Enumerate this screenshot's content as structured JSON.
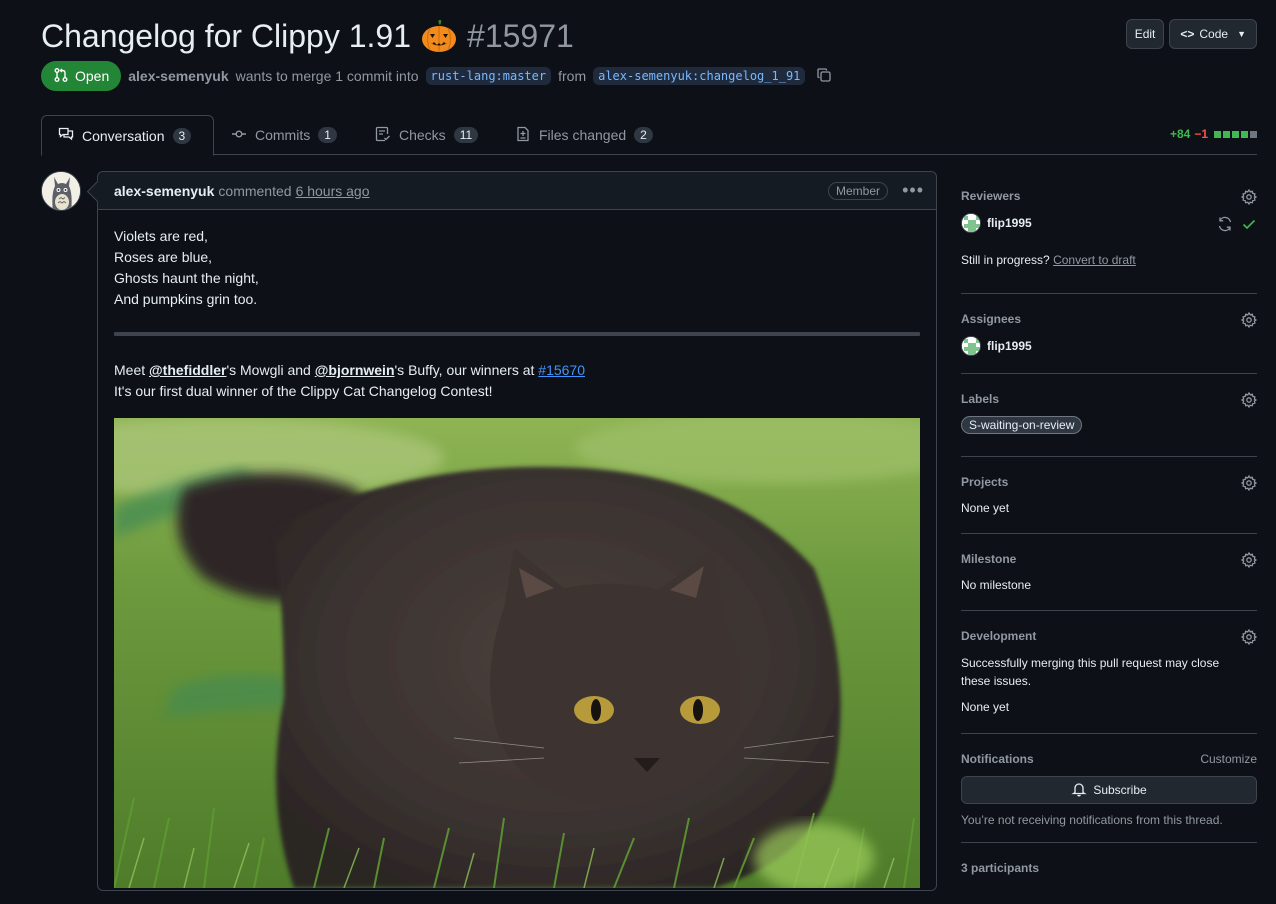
{
  "header": {
    "title": "Changelog for Clippy 1.91",
    "number": "#15971",
    "edit_label": "Edit",
    "code_label": "Code"
  },
  "meta": {
    "state": "Open",
    "author": "alex-semenyuk",
    "merge_text": "wants to merge 1 commit into",
    "base_branch": "rust-lang:master",
    "from_text": "from",
    "head_branch": "alex-semenyuk:changelog_1_91"
  },
  "tabs": [
    {
      "label": "Conversation",
      "count": "3"
    },
    {
      "label": "Commits",
      "count": "1"
    },
    {
      "label": "Checks",
      "count": "11"
    },
    {
      "label": "Files changed",
      "count": "2"
    }
  ],
  "diffstat": {
    "additions": "+84",
    "deletions": "−1",
    "blocks": [
      "green",
      "green",
      "green",
      "green",
      "gray"
    ]
  },
  "comment": {
    "author": "alex-semenyuk",
    "action": "commented",
    "time": "6 hours ago",
    "role": "Member",
    "poem": [
      "Violets are red,",
      "Roses are blue,",
      "Ghosts haunt the night,",
      "And pumpkins grin too."
    ],
    "meet": "Meet",
    "mention1": "@thefiddler",
    "after_mention1": "'s Mowgli and",
    "mention2": "@bjornwein",
    "after_mention2": "'s Buffy, our winners at",
    "issue_link": "#15670",
    "line2": "It's our first dual winner of the Clippy Cat Changelog Contest!"
  },
  "sidebar": {
    "reviewers": {
      "title": "Reviewers",
      "user": "flip1995",
      "in_progress": "Still in progress?",
      "convert": "Convert to draft"
    },
    "assignees": {
      "title": "Assignees",
      "user": "flip1995"
    },
    "labels": {
      "title": "Labels",
      "label": "S-waiting-on-review"
    },
    "projects": {
      "title": "Projects",
      "value": "None yet"
    },
    "milestone": {
      "title": "Milestone",
      "value": "No milestone"
    },
    "development": {
      "title": "Development",
      "text": "Successfully merging this pull request may close these issues.",
      "value": "None yet"
    },
    "notifications": {
      "title": "Notifications",
      "customize": "Customize",
      "subscribe": "Subscribe",
      "note": "You’re not receiving notifications from this thread."
    },
    "participants": {
      "title": "3 participants"
    }
  },
  "colors": {
    "open": "#238636",
    "link": "#4493f8",
    "plus": "#3fb950",
    "minus": "#f85149"
  }
}
